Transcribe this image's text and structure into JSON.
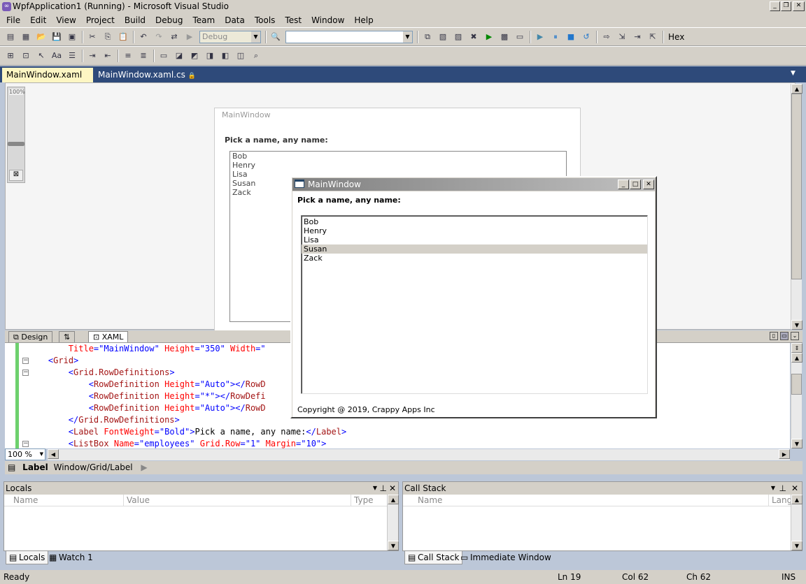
{
  "window": {
    "title": "WpfApplication1 (Running) - Microsoft Visual Studio"
  },
  "menu": [
    "File",
    "Edit",
    "View",
    "Project",
    "Build",
    "Debug",
    "Team",
    "Data",
    "Tools",
    "Test",
    "Window",
    "Help"
  ],
  "toolbar": {
    "config": "Debug",
    "find_combo": "",
    "hex_label": "Hex"
  },
  "tabs": [
    {
      "label": "MainWindow.xaml"
    },
    {
      "label": "MainWindow.xaml.cs"
    }
  ],
  "designer": {
    "zoom_label": "100%",
    "window_title": "MainWindow",
    "label": "Pick a name, any name:",
    "names": [
      "Bob",
      "Henry",
      "Lisa",
      "Susan",
      "Zack"
    ]
  },
  "split": {
    "design": "Design",
    "swap": "⇅",
    "xaml": "XAML"
  },
  "code": {
    "lines": [
      {
        "indent": "        ",
        "parts": [
          [
            "attr",
            "Title"
          ],
          [
            "br",
            "="
          ],
          [
            "val",
            "\"MainWindow\""
          ],
          [
            "txt",
            " "
          ],
          [
            "attr",
            "Height"
          ],
          [
            "br",
            "="
          ],
          [
            "val",
            "\"350\""
          ],
          [
            "txt",
            " "
          ],
          [
            "attr",
            "Width"
          ],
          [
            "br",
            "="
          ],
          [
            "val",
            "\""
          ]
        ]
      },
      {
        "indent": "    ",
        "parts": [
          [
            "br",
            "<"
          ],
          [
            "tag",
            "Grid"
          ],
          [
            "br",
            ">"
          ]
        ]
      },
      {
        "indent": "        ",
        "parts": [
          [
            "br",
            "<"
          ],
          [
            "tag",
            "Grid.RowDefinitions"
          ],
          [
            "br",
            ">"
          ]
        ]
      },
      {
        "indent": "            ",
        "parts": [
          [
            "br",
            "<"
          ],
          [
            "tag",
            "RowDefinition"
          ],
          [
            "txt",
            " "
          ],
          [
            "attr",
            "Height"
          ],
          [
            "br",
            "="
          ],
          [
            "val",
            "\"Auto\""
          ],
          [
            "br",
            "></"
          ],
          [
            "tag",
            "RowD"
          ]
        ]
      },
      {
        "indent": "            ",
        "parts": [
          [
            "br",
            "<"
          ],
          [
            "tag",
            "RowDefinition"
          ],
          [
            "txt",
            " "
          ],
          [
            "attr",
            "Height"
          ],
          [
            "br",
            "="
          ],
          [
            "val",
            "\"*\""
          ],
          [
            "br",
            "></"
          ],
          [
            "tag",
            "RowDefi"
          ]
        ]
      },
      {
        "indent": "            ",
        "parts": [
          [
            "br",
            "<"
          ],
          [
            "tag",
            "RowDefinition"
          ],
          [
            "txt",
            " "
          ],
          [
            "attr",
            "Height"
          ],
          [
            "br",
            "="
          ],
          [
            "val",
            "\"Auto\""
          ],
          [
            "br",
            "></"
          ],
          [
            "tag",
            "RowD"
          ]
        ]
      },
      {
        "indent": "        ",
        "parts": [
          [
            "br",
            "</"
          ],
          [
            "tag",
            "Grid.RowDefinitions"
          ],
          [
            "br",
            ">"
          ]
        ]
      },
      {
        "indent": "        ",
        "parts": [
          [
            "br",
            "<"
          ],
          [
            "tag",
            "Label"
          ],
          [
            "txt",
            " "
          ],
          [
            "attr",
            "FontWeight"
          ],
          [
            "br",
            "="
          ],
          [
            "val",
            "\"Bold\""
          ],
          [
            "br",
            ">"
          ],
          [
            "txt",
            "Pick a name, any name:"
          ],
          [
            "br",
            "</"
          ],
          [
            "tag",
            "Label"
          ],
          [
            "br",
            ">"
          ]
        ]
      },
      {
        "indent": "        ",
        "parts": [
          [
            "br",
            "<"
          ],
          [
            "tag",
            "ListBox"
          ],
          [
            "txt",
            " "
          ],
          [
            "attr",
            "Name"
          ],
          [
            "br",
            "="
          ],
          [
            "val",
            "\"employees\""
          ],
          [
            "txt",
            " "
          ],
          [
            "attr",
            "Grid.Row"
          ],
          [
            "br",
            "="
          ],
          [
            "val",
            "\"1\""
          ],
          [
            "txt",
            " "
          ],
          [
            "attr",
            "Margin"
          ],
          [
            "br",
            "="
          ],
          [
            "val",
            "\"10\""
          ],
          [
            "br",
            ">"
          ]
        ]
      }
    ]
  },
  "editor": {
    "zoom": "100 %",
    "crumb_bold": "Label",
    "crumb_path": "Window/Grid/Label"
  },
  "locals": {
    "title": "Locals",
    "cols": [
      "Name",
      "Value",
      "Type"
    ]
  },
  "callstack": {
    "title": "Call Stack",
    "cols": [
      "Name",
      "Lang"
    ]
  },
  "bottom_tabs_left": [
    "Locals",
    "Watch 1"
  ],
  "bottom_tabs_right": [
    "Call Stack",
    "Immediate Window"
  ],
  "status": {
    "ready": "Ready",
    "ln": "Ln 19",
    "col": "Col 62",
    "ch": "Ch 62",
    "ins": "INS"
  },
  "running": {
    "title": "MainWindow",
    "label": "Pick a name, any name:",
    "names": [
      "Bob",
      "Henry",
      "Lisa",
      "Susan",
      "Zack"
    ],
    "selected": "Susan",
    "footer": "Copyright @ 2019, Crappy Apps Inc"
  }
}
